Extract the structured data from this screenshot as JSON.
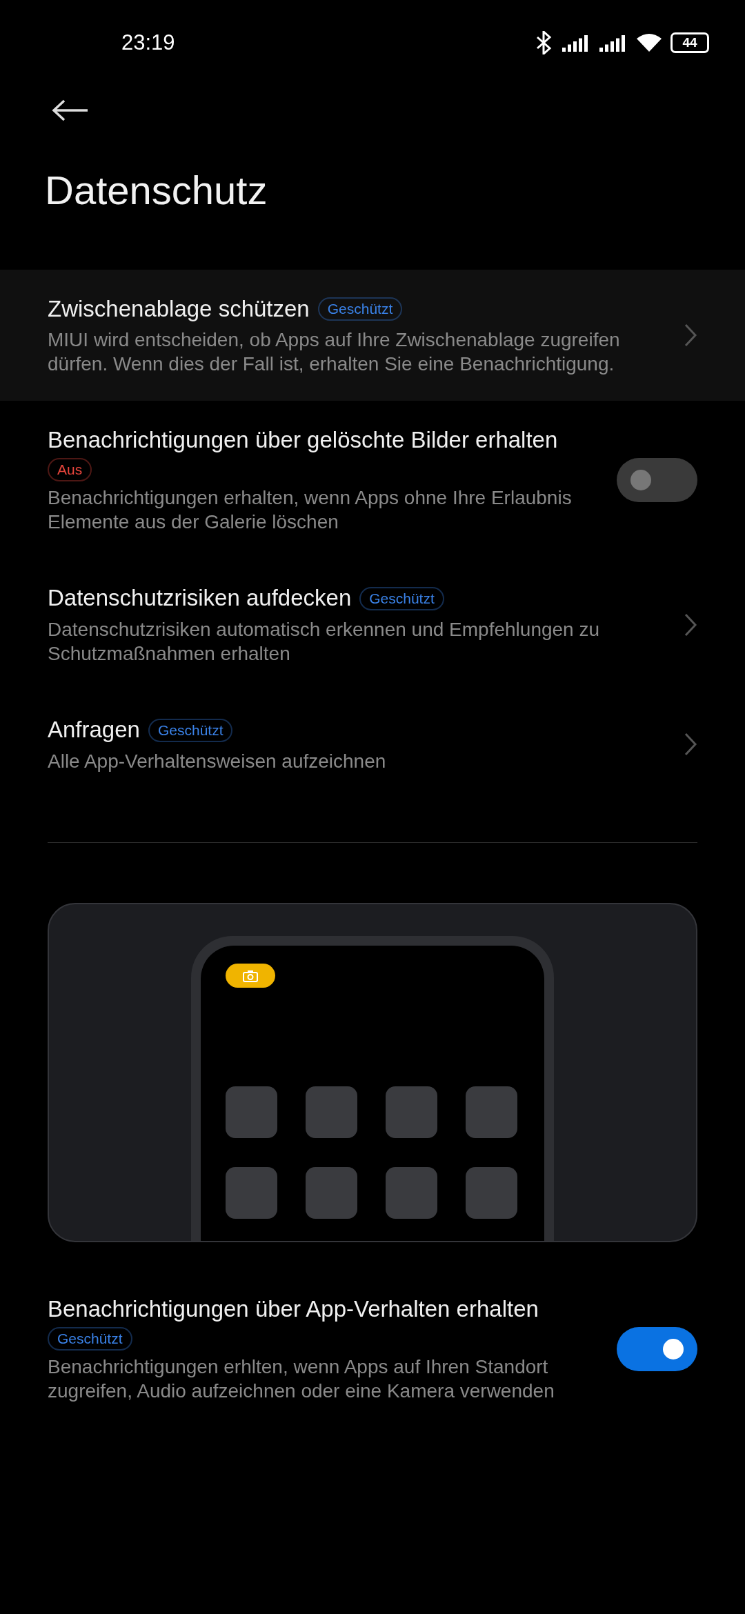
{
  "status_bar": {
    "time": "23:19",
    "battery": "44"
  },
  "header": {
    "title": "Datenschutz"
  },
  "items": [
    {
      "kind": "link",
      "highlighted": true,
      "title": "Zwischenablage schützen",
      "badge": {
        "text": "Geschützt",
        "color": "#3a82e8"
      },
      "description": "MIUI wird entscheiden, ob Apps auf Ihre Zwischenablage zugreifen dürfen. Wenn dies der Fall ist, erhalten Sie eine Benachrichtigung."
    },
    {
      "kind": "toggle",
      "highlighted": false,
      "on": false,
      "title": "Benachrichtigungen über gelöschte Bilder erhalten",
      "badge": {
        "text": "Aus",
        "color": "#e8453c"
      },
      "description": "Benachrichtigungen erhalten, wenn Apps ohne Ihre Erlaubnis Elemente aus der Galerie löschen"
    },
    {
      "kind": "link",
      "highlighted": false,
      "title": "Datenschutzrisiken aufdecken",
      "badge": {
        "text": "Geschützt",
        "color": "#3a82e8"
      },
      "description": "Datenschutzrisiken automatisch erkennen und Empfehlungen zu Schutzmaßnahmen erhalten"
    },
    {
      "kind": "link",
      "highlighted": false,
      "title": "Anfragen",
      "badge": {
        "text": "Geschützt",
        "color": "#3a82e8"
      },
      "description": "Alle App-Verhaltensweisen aufzeichnen"
    }
  ],
  "bottom_item": {
    "kind": "toggle",
    "highlighted": false,
    "on": true,
    "title": "Benachrichtigungen über App-Verhalten erhalten",
    "badge": {
      "text": "Geschützt",
      "color": "#3a82e8"
    },
    "description": "Benachrichtigungen erhlten, wenn Apps auf Ihren Standort zugreifen, Audio aufzeichnen oder eine Kamera verwenden"
  }
}
